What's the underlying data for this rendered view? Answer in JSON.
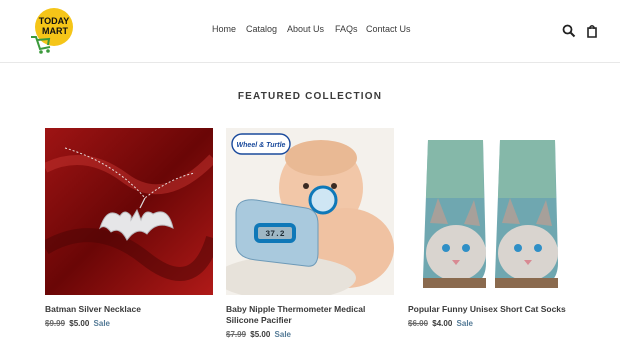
{
  "store": {
    "logo_text_1": "TODAY",
    "logo_text_2": "MART",
    "accent": "#f5c518"
  },
  "nav": {
    "items": [
      "Home",
      "Catalog",
      "About Us",
      "FAQs",
      "Contact Us"
    ]
  },
  "icons": {
    "search": "search-icon",
    "cart": "cart-icon"
  },
  "section": {
    "title": "FEATURED COLLECTION"
  },
  "products": [
    {
      "title": "Batman Silver Necklace",
      "old_price": "$9.99",
      "price": "$5.00",
      "badge": "Sale"
    },
    {
      "title": "Baby Nipple Thermometer Medical Silicone Pacifier",
      "old_price": "$7.99",
      "price": "$5.00",
      "badge": "Sale",
      "brand_badge": "Wheel & Turtle",
      "device_text": "37.2"
    },
    {
      "title": "Popular Funny Unisex Short Cat Socks",
      "old_price": "$6.00",
      "price": "$4.00",
      "badge": "Sale"
    }
  ]
}
